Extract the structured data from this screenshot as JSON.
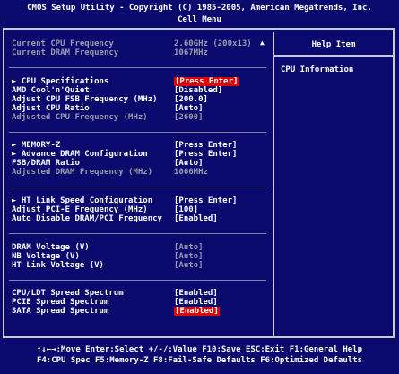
{
  "title": {
    "line1": "CMOS Setup Utility - Copyright (C) 1985-2005, American Megatrends, Inc.",
    "line2": "Cell Menu"
  },
  "help": {
    "title": "Help Item",
    "text": "CPU Information",
    "scroll_arrow": "▲"
  },
  "items": {
    "current_cpu_freq": {
      "label": "Current CPU Frequency",
      "value": "2.60GHz (200x13)"
    },
    "current_dram_freq": {
      "label": "Current DRAM Frequency",
      "value": "1067MHz"
    },
    "cpu_spec": {
      "label": "► CPU Specifications",
      "value": "[Press Enter]"
    },
    "amd_cool": {
      "label": "AMD Cool'n'Quiet",
      "value": "[Disabled]"
    },
    "fsb_freq": {
      "label": "Adjust CPU FSB Frequency (MHz)",
      "value": "[200.0]"
    },
    "cpu_ratio": {
      "label": "Adjust CPU Ratio",
      "value": "[Auto]"
    },
    "adj_cpu_freq": {
      "label": "Adjusted CPU Frequency (MHz)",
      "value": "[2600]"
    },
    "memory_z": {
      "label": "► MEMORY-Z",
      "value": "[Press Enter]"
    },
    "adv_dram": {
      "label": "► Advance DRAM Configuration",
      "value": "[Press Enter]"
    },
    "fsb_dram": {
      "label": "FSB/DRAM Ratio",
      "value": "[Auto]"
    },
    "adj_dram_freq": {
      "label": "Adjusted DRAM Frequency (MHz)",
      "value": "1066MHz"
    },
    "ht_link": {
      "label": "► HT Link Speed Configuration",
      "value": "[Press Enter]"
    },
    "pcie_freq": {
      "label": "Adjust PCI-E Frequency (MHz)",
      "value": "[100]"
    },
    "auto_disable": {
      "label": "Auto Disable DRAM/PCI Frequency",
      "value": "[Enabled]"
    },
    "dram_volt": {
      "label": "DRAM Voltage (V)",
      "value": "[Auto]"
    },
    "nb_volt": {
      "label": "NB Voltage (V)",
      "value": "[Auto]"
    },
    "ht_volt": {
      "label": "HT Link Voltage (V)",
      "value": "[Auto]"
    },
    "cpu_ldt": {
      "label": "CPU/LDT Spread Spectrum",
      "value": "[Enabled]"
    },
    "pcie_spread": {
      "label": "PCIE Spread Spectrum",
      "value": "[Enabled]"
    },
    "sata_spread": {
      "label": "SATA Spread Spectrum",
      "value": "[Enabled]"
    }
  },
  "footer": {
    "line1": "↑↓←→:Move  Enter:Select  +/-/:Value  F10:Save  ESC:Exit  F1:General Help",
    "line2": "F4:CPU Spec  F5:Memory-Z  F8:Fail-Safe Defaults  F6:Optimized Defaults"
  }
}
